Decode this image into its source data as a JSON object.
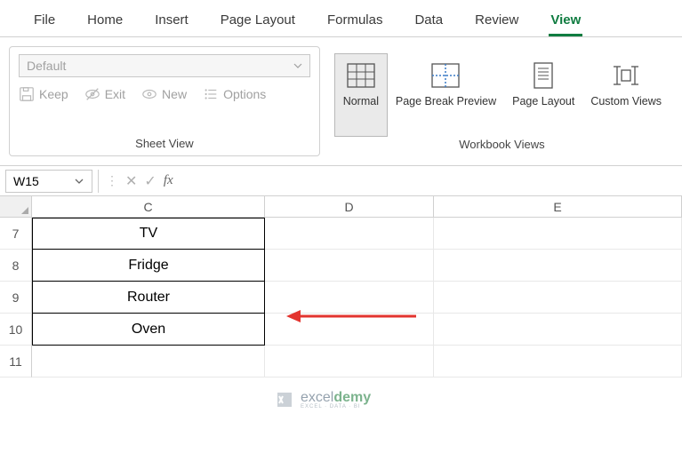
{
  "tabs": {
    "file": "File",
    "home": "Home",
    "insert": "Insert",
    "page_layout": "Page Layout",
    "formulas": "Formulas",
    "data": "Data",
    "review": "Review",
    "view": "View"
  },
  "ribbon": {
    "sheet_view": {
      "label": "Sheet View",
      "dropdown": "Default",
      "keep": "Keep",
      "exit": "Exit",
      "new": "New",
      "options": "Options"
    },
    "workbook_views": {
      "label": "Workbook Views",
      "normal": "Normal",
      "page_break": "Page Break Preview",
      "page_layout": "Page Layout",
      "custom_views": "Custom Views"
    }
  },
  "formula_bar": {
    "namebox": "W15",
    "value": ""
  },
  "columns": {
    "c": "C",
    "d": "D",
    "e": "E"
  },
  "rows": {
    "r7": {
      "num": "7",
      "c": "TV"
    },
    "r8": {
      "num": "8",
      "c": "Fridge"
    },
    "r9": {
      "num": "9",
      "c": "Router"
    },
    "r10": {
      "num": "10",
      "c": "Oven"
    },
    "r11": {
      "num": "11"
    }
  },
  "watermark": {
    "brand_a": "excel",
    "brand_b": "demy",
    "sub": "EXCEL · DATA · BI"
  }
}
